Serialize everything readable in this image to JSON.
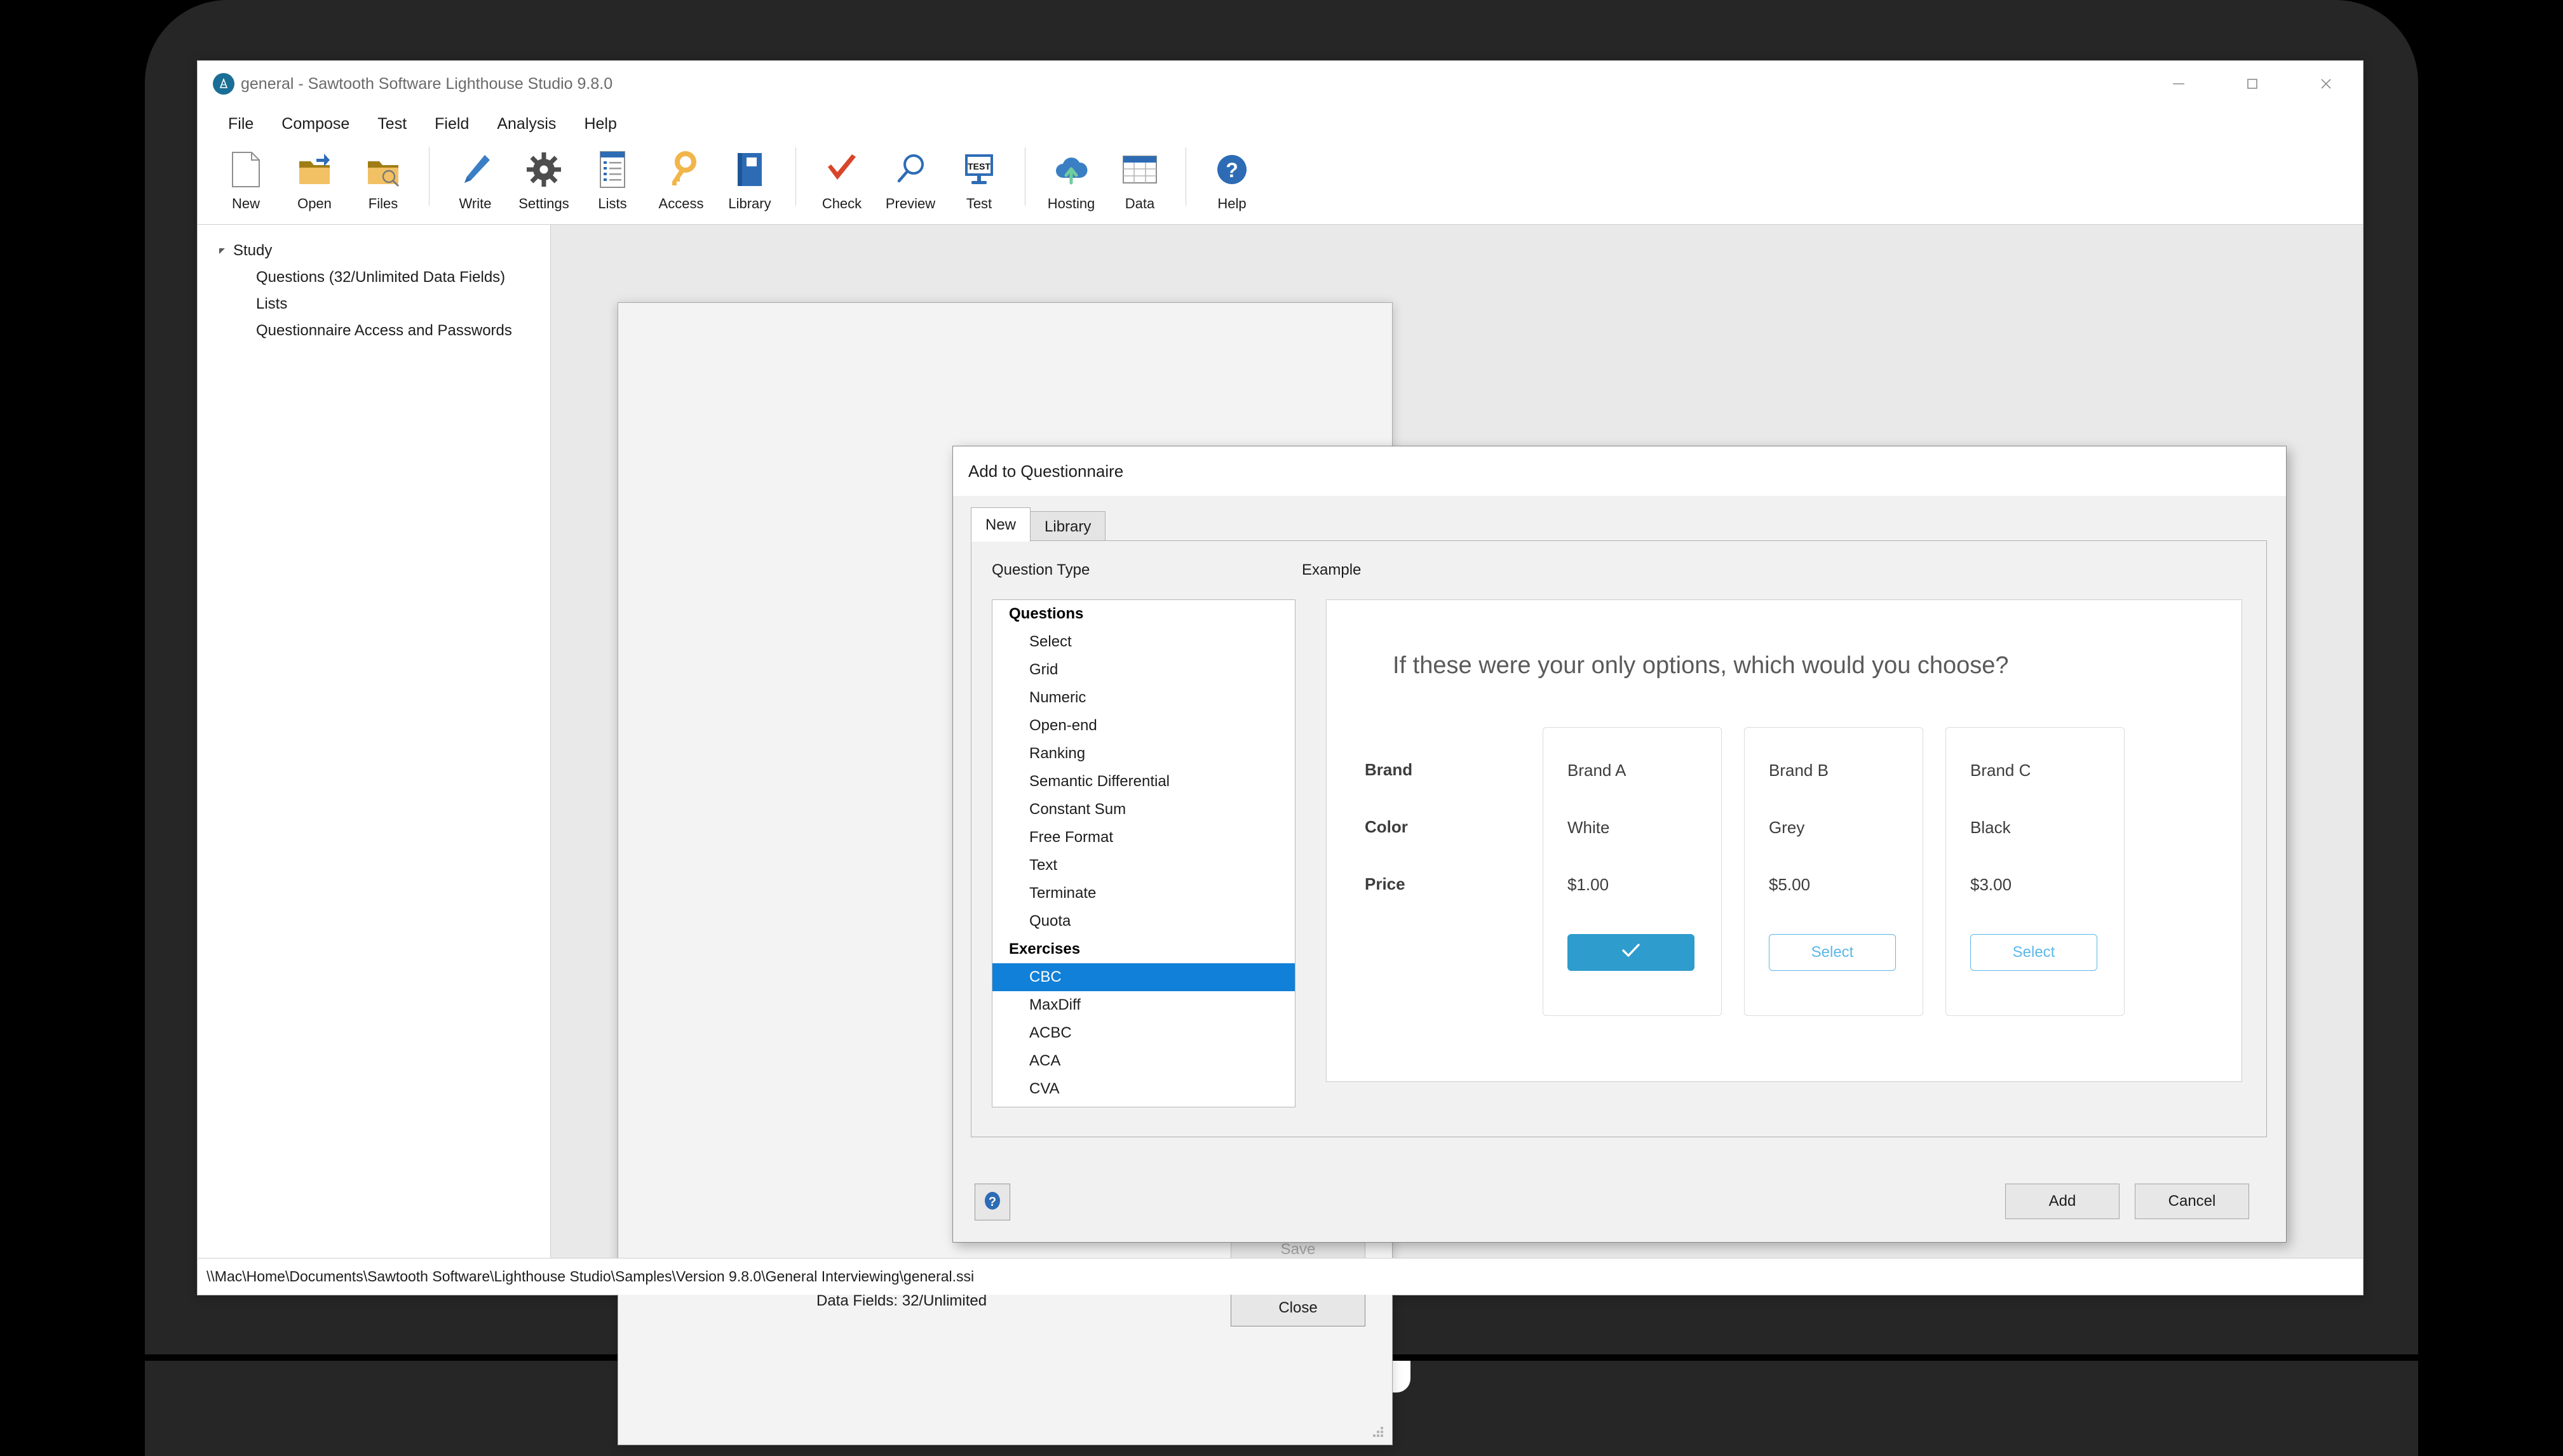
{
  "window": {
    "title": "general - Sawtooth Software Lighthouse Studio 9.8.0",
    "app_icon": "lighthouse-logo-icon",
    "controls": {
      "minimize": "minimize-icon",
      "maximize": "maximize-icon",
      "close": "close-icon"
    }
  },
  "menu": {
    "items": [
      "File",
      "Compose",
      "Test",
      "Field",
      "Analysis",
      "Help"
    ]
  },
  "toolbar": {
    "groups": [
      {
        "buttons": [
          {
            "label": "New",
            "icon": "new-document-icon"
          },
          {
            "label": "Open",
            "icon": "open-folder-icon"
          },
          {
            "label": "Files",
            "icon": "folder-search-icon"
          }
        ]
      },
      {
        "buttons": [
          {
            "label": "Write",
            "icon": "pencil-icon"
          },
          {
            "label": "Settings",
            "icon": "gear-icon"
          },
          {
            "label": "Lists",
            "icon": "list-icon"
          },
          {
            "label": "Access",
            "icon": "key-icon"
          },
          {
            "label": "Library",
            "icon": "book-icon"
          }
        ]
      },
      {
        "buttons": [
          {
            "label": "Check",
            "icon": "checkmark-icon"
          },
          {
            "label": "Preview",
            "icon": "magnifier-icon"
          },
          {
            "label": "Test",
            "icon": "test-monitor-icon"
          }
        ]
      },
      {
        "buttons": [
          {
            "label": "Hosting",
            "icon": "cloud-upload-icon"
          },
          {
            "label": "Data",
            "icon": "table-icon"
          }
        ]
      },
      {
        "buttons": [
          {
            "label": "Help",
            "icon": "question-circle-icon"
          }
        ]
      }
    ]
  },
  "tree": {
    "root": {
      "label": "Study",
      "arrow_icon": "triangle-expanded-icon"
    },
    "children": [
      "Questions (32/Unlimited Data Fields)",
      "Lists",
      "Questionnaire Access and Passwords"
    ]
  },
  "questionnaire_window": {
    "data_fields_label": "Data Fields: 32/Unlimited",
    "save_label": "Save",
    "close_label": "Close",
    "resize_grip_icon": "resize-grip-icon"
  },
  "dialog": {
    "title": "Add to Questionnaire",
    "tabs": [
      {
        "label": "New",
        "active": true
      },
      {
        "label": "Library",
        "active": false
      }
    ],
    "question_type_label": "Question Type",
    "example_label": "Example",
    "list": [
      {
        "type": "group",
        "label": "Questions"
      },
      {
        "type": "item",
        "label": "Select",
        "selected": false
      },
      {
        "type": "item",
        "label": "Grid",
        "selected": false
      },
      {
        "type": "item",
        "label": "Numeric",
        "selected": false
      },
      {
        "type": "item",
        "label": "Open-end",
        "selected": false
      },
      {
        "type": "item",
        "label": "Ranking",
        "selected": false
      },
      {
        "type": "item",
        "label": "Semantic Differential",
        "selected": false
      },
      {
        "type": "item",
        "label": "Constant Sum",
        "selected": false
      },
      {
        "type": "item",
        "label": "Free Format",
        "selected": false
      },
      {
        "type": "item",
        "label": "Text",
        "selected": false
      },
      {
        "type": "item",
        "label": "Terminate",
        "selected": false
      },
      {
        "type": "item",
        "label": "Quota",
        "selected": false
      },
      {
        "type": "group",
        "label": "Exercises"
      },
      {
        "type": "item",
        "label": "CBC",
        "selected": true
      },
      {
        "type": "item",
        "label": "MaxDiff",
        "selected": false
      },
      {
        "type": "item",
        "label": "ACBC",
        "selected": false
      },
      {
        "type": "item",
        "label": "ACA",
        "selected": false
      },
      {
        "type": "item",
        "label": "CVA",
        "selected": false
      }
    ],
    "selected_color": "#1180d8",
    "help_icon": "question-circle-icon",
    "add_label": "Add",
    "cancel_label": "Cancel"
  },
  "example": {
    "question": "If these were your only options, which would you choose?",
    "attributes": [
      "Brand",
      "Color",
      "Price"
    ],
    "concepts": [
      {
        "values": [
          "Brand A",
          "White",
          "$1.00"
        ],
        "button_label": "",
        "chosen": true,
        "button_icon": "checkmark-icon"
      },
      {
        "values": [
          "Brand B",
          "Grey",
          "$5.00"
        ],
        "button_label": "Select",
        "chosen": false,
        "button_icon": ""
      },
      {
        "values": [
          "Brand C",
          "Black",
          "$3.00"
        ],
        "button_label": "Select",
        "chosen": false,
        "button_icon": ""
      }
    ],
    "chosen_color": "#2e9ccc",
    "select_color": "#5bb8e8"
  },
  "status": {
    "path": "\\\\Mac\\Home\\Documents\\Sawtooth Software\\Lighthouse Studio\\Samples\\Version 9.8.0\\General Interviewing\\general.ssi"
  }
}
